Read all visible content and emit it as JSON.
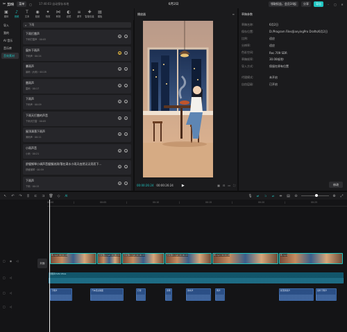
{
  "titlebar": {
    "app_name": "剪映",
    "menu": "菜单",
    "autosave": "17:40:03 自动保存本地",
    "project_title": "6月2日",
    "hire": "寻求协作",
    "vip": "领取权益，会员34起",
    "share": "分享",
    "export": "导出"
  },
  "toolbar": [
    {
      "label": "媒体",
      "icon": "▣"
    },
    {
      "label": "音频",
      "icon": "♪"
    },
    {
      "label": "文本",
      "icon": "T"
    },
    {
      "label": "贴纸",
      "icon": "◉"
    },
    {
      "label": "特效",
      "icon": "✦"
    },
    {
      "label": "转场",
      "icon": "⋈"
    },
    {
      "label": "滤镜",
      "icon": "◐"
    },
    {
      "label": "调节",
      "icon": "≡"
    },
    {
      "label": "智能包装",
      "icon": "✚"
    },
    {
      "label": "模板",
      "icon": "▤"
    }
  ],
  "sidebar": [
    "导入",
    "我的",
    "AI 音乐",
    "音乐库",
    "音效素材"
  ],
  "library": {
    "search": "下雨",
    "items": [
      {
        "title": "下雨打雷声",
        "sub": "下雨打雷声 · 00:05",
        "fav": false
      },
      {
        "title": "窗外下雨声",
        "sub": "下雨声 · 00:24",
        "fav": true
      },
      {
        "title": "暴雨声",
        "sub": "暴雨（大雨）· 00:28",
        "fav": false
      },
      {
        "title": "雷雨声",
        "sub": "雷雨 · 00:17",
        "fav": false
      },
      {
        "title": "下雨声",
        "sub": "下雨声 · 00:09",
        "fav": false
      },
      {
        "title": "下雨天打雷的声音",
        "sub": "下雨天打雷 · 00:05",
        "fav": false
      },
      {
        "title": "屋顶滴落下雨声",
        "sub": "滴雨声 · 00:11",
        "fav": false
      },
      {
        "title": "小雨声音",
        "sub": "小雨 · 00:21",
        "fav": false
      },
      {
        "title": "舒缓钢琴小调声音缓慢流淌/落在滴水小雨天由然泛泛亮而下...",
        "sub": "舒缓钢琴 · 00:59",
        "fav": false
      },
      {
        "title": "下雨声",
        "sub": "下雨 · 00:15",
        "fav": false
      }
    ]
  },
  "player": {
    "title": "播放器",
    "timecode": "00:00:26:24",
    "duration": "00:00:26:24",
    "play_icon": "▶"
  },
  "inspector": {
    "title": "草稿参数",
    "rows": [
      {
        "k": "草稿名称:",
        "v": "6月2日"
      },
      {
        "k": "保存位置:",
        "v": "D:/Program Files/JianyingPro Drafts/6月2日"
      },
      {
        "k": "比例:",
        "v": "适应"
      },
      {
        "k": "分辨率:",
        "v": "适应"
      },
      {
        "k": "色彩空间:",
        "v": "Rec.709 SDR"
      },
      {
        "k": "草稿帧率:",
        "v": "30.00帧/秒"
      },
      {
        "k": "导入方式:",
        "v": "保留在原有位置"
      }
    ],
    "rows2": [
      {
        "k": "代理模式:",
        "v": "未开启"
      },
      {
        "k": "自由层级:",
        "v": "已开启"
      }
    ],
    "modify": "修改"
  },
  "timeline": {
    "ruler": [
      "00:00",
      "|",
      "00:05",
      "|",
      "00:10",
      "|",
      "00:15",
      "|",
      "00:20",
      "|",
      "00:25"
    ],
    "cover": "封面",
    "video_clips": [
      {
        "label": "雨.mp4  00:00:03"
      },
      {
        "label": "无标题1.mp4  00:00:03"
      },
      {
        "label": "无标题2.mp4  00:00:03"
      },
      {
        "label": "无标题3.mp4  00:00:03"
      },
      {
        "label": "雨.mp4  00:00:05"
      },
      {
        "label": "雨.mp4"
      }
    ],
    "music_clip": "听雨声/Cafe Vibes",
    "audio_clips": [
      {
        "label": "下雨声"
      },
      {
        "label": "汽车经过路面"
      },
      {
        "label": "打雷"
      },
      {
        "label": "雷雨"
      },
      {
        "label": "倒水声"
      },
      {
        "label": "雨声"
      },
      {
        "label": "屋顶滴落声"
      },
      {
        "label": "窗外下雨声"
      }
    ]
  },
  "colors": {
    "accent": "#1ec5c1",
    "panel": "#1b1b1d",
    "audio": "#2b4f86",
    "music": "#12556a"
  }
}
